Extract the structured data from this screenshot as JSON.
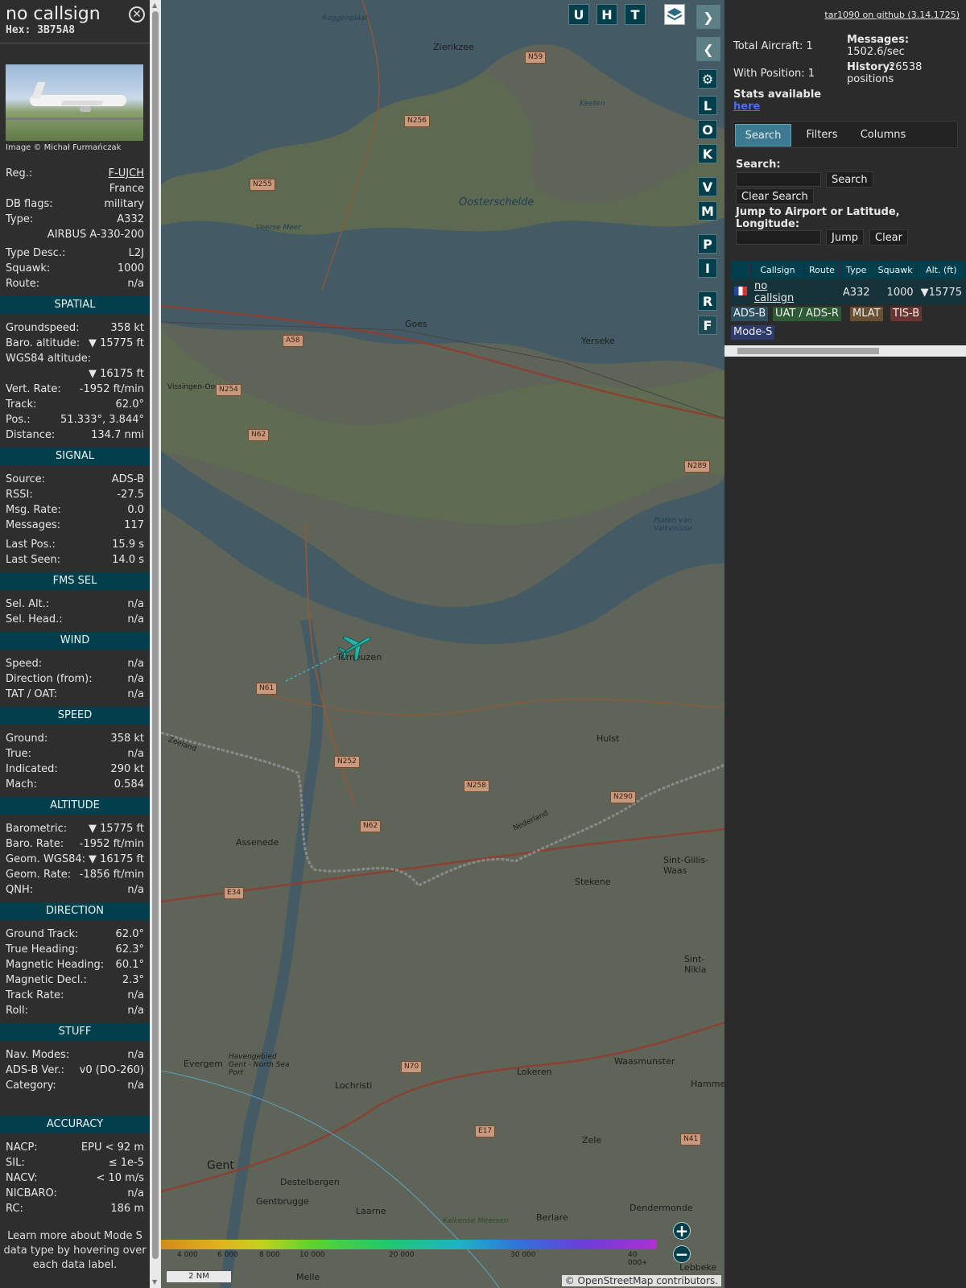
{
  "selected": {
    "callsign": "no callsign",
    "hex": "Hex: 3B75A8",
    "image_credit": "Image © Michał Furmańczak",
    "info": [
      {
        "k": "Reg.:",
        "v": "F-UJCH"
      },
      {
        "k": "",
        "v": "France"
      },
      {
        "k": "DB flags:",
        "v": "military"
      },
      {
        "k": "Type:",
        "v": "A332"
      },
      {
        "k": "",
        "v": "AIRBUS A-330-200"
      },
      {
        "k": "Type Desc.:",
        "v": "L2J"
      },
      {
        "k": "Squawk:",
        "v": "1000"
      },
      {
        "k": "Route:",
        "v": "n/a"
      }
    ],
    "sections": [
      {
        "title": "SPATIAL",
        "rows": [
          {
            "k": "Groundspeed:",
            "v": "358 kt"
          },
          {
            "k": "Baro. altitude:",
            "v": "▼ 15775 ft"
          },
          {
            "k": "WGS84 altitude:",
            "v": ""
          },
          {
            "k": "",
            "v": "▼ 16175 ft"
          },
          {
            "k": "Vert. Rate:",
            "v": "-1952 ft/min"
          },
          {
            "k": "Track:",
            "v": "62.0°"
          },
          {
            "k": "Pos.:",
            "v": "51.333°, 3.844°"
          },
          {
            "k": "Distance:",
            "v": "134.7 nmi"
          }
        ]
      },
      {
        "title": "SIGNAL",
        "rows": [
          {
            "k": "Source:",
            "v": "ADS-B"
          },
          {
            "k": "RSSI:",
            "v": "-27.5"
          },
          {
            "k": "Msg. Rate:",
            "v": "0.0"
          },
          {
            "k": "Messages:",
            "v": "117"
          },
          {
            "k": "Last Pos.:",
            "v": "15.9 s"
          },
          {
            "k": "Last Seen:",
            "v": "14.0 s"
          }
        ]
      },
      {
        "title": "FMS SEL",
        "rows": [
          {
            "k": "Sel. Alt.:",
            "v": "n/a"
          },
          {
            "k": "Sel. Head.:",
            "v": "n/a"
          }
        ]
      },
      {
        "title": "WIND",
        "rows": [
          {
            "k": "Speed:",
            "v": "n/a"
          },
          {
            "k": "Direction (from):",
            "v": "n/a"
          },
          {
            "k": "TAT / OAT:",
            "v": "n/a"
          }
        ]
      },
      {
        "title": "SPEED",
        "rows": [
          {
            "k": "Ground:",
            "v": "358 kt"
          },
          {
            "k": "True:",
            "v": "n/a"
          },
          {
            "k": "Indicated:",
            "v": "290 kt"
          },
          {
            "k": "Mach:",
            "v": "0.584"
          }
        ]
      },
      {
        "title": "ALTITUDE",
        "rows": [
          {
            "k": "Barometric:",
            "v": "▼ 15775 ft"
          },
          {
            "k": "Baro. Rate:",
            "v": "-1952 ft/min"
          },
          {
            "k": "Geom. WGS84:",
            "v": "▼ 16175 ft"
          },
          {
            "k": "Geom. Rate:",
            "v": "-1856 ft/min"
          },
          {
            "k": "QNH:",
            "v": "n/a"
          }
        ]
      },
      {
        "title": "DIRECTION",
        "rows": [
          {
            "k": "Ground Track:",
            "v": "62.0°"
          },
          {
            "k": "True Heading:",
            "v": "62.3°"
          },
          {
            "k": "Magnetic Heading:",
            "v": "60.1°"
          },
          {
            "k": "Magnetic Decl.:",
            "v": "2.3°"
          },
          {
            "k": "Track Rate:",
            "v": "n/a"
          },
          {
            "k": "Roll:",
            "v": "n/a"
          }
        ]
      },
      {
        "title": "STUFF",
        "rows": [
          {
            "k": "Nav. Modes:",
            "v": "n/a"
          },
          {
            "k": "ADS-B Ver.:",
            "v": "v0 (DO-260)"
          },
          {
            "k": "Category:",
            "v": "n/a"
          }
        ]
      },
      {
        "title": "ACCURACY",
        "rows": [
          {
            "k": "NACP:",
            "v": "EPU < 92 m"
          },
          {
            "k": "SIL:",
            "v": "≤ 1e-5"
          },
          {
            "k": "NACV:",
            "v": "< 10 m/s"
          },
          {
            "k": "NICBARO:",
            "v": "n/a"
          },
          {
            "k": "RC:",
            "v": "186 m"
          }
        ]
      }
    ],
    "footer": "Learn more about Mode S data type by hovering over each data label."
  },
  "map": {
    "buttons_top": [
      "U",
      "H",
      "T"
    ],
    "buttons_side": [
      "L",
      "O",
      "K",
      "V",
      "M",
      "P",
      "I",
      "R",
      "F"
    ],
    "scale": "2 NM",
    "attribution": "© OpenStreetMap contributors.",
    "legend_ticks": [
      "4 000",
      "6 000",
      "8 000",
      "10 000",
      "20 000",
      "30 000",
      "40 000+"
    ],
    "places": [
      "Zierikzee",
      "Goes",
      "Yerseke",
      "Terneuzen",
      "Hulst",
      "Assenede",
      "Stekene",
      "Sint-Gillis-Waas",
      "Sint-Nikla",
      "Evergem",
      "Lochristi",
      "Lokeren",
      "Waasmunster",
      "Hamme",
      "Zele",
      "Gent",
      "Destelbergen",
      "Gentbrugge",
      "Laarne",
      "Berlare",
      "Dendermonde",
      "Lebbeke",
      "Melle",
      "Kalkense Meersen",
      "Veerse Meer",
      "Oosterschelde",
      "Roggenplaat",
      "Vissingen-Oost",
      "Zeeland",
      "Nederland",
      "Platen van Valkenisse",
      "Keeten",
      "Havengebied Gent - North Sea Port"
    ],
    "roads": [
      "N59",
      "N256",
      "N255",
      "A58",
      "N254",
      "N62",
      "N289",
      "N61",
      "N252",
      "N258",
      "N290",
      "N62",
      "E34",
      "N70",
      "E17",
      "N41"
    ]
  },
  "panel": {
    "github": "tar1090 on github (3.14.1725)",
    "total_aircraft": "Total Aircraft: 1",
    "with_position": "With Position: 1",
    "stats_available": "Stats available",
    "stats_link": "here",
    "messages_label": "Messages:",
    "messages_rate": "1502.6/sec",
    "history_label": "History:",
    "history_value": "26538 positions",
    "tabs": [
      "Search",
      "Filters",
      "Columns"
    ],
    "search_label": "Search:",
    "search_button": "Search",
    "clear_search": "Clear Search",
    "jump_label": "Jump to Airport or Latitude, Longitude:",
    "jump_button": "Jump",
    "clear_button": "Clear",
    "table_headers": [
      "Callsign",
      "Route",
      "Type",
      "Squawk",
      "Alt. (ft)"
    ],
    "table_rows": [
      [
        "no callsign",
        "",
        "A332",
        "1000",
        "▼15775"
      ]
    ],
    "source_tags": [
      "ADS-B",
      "UAT / ADS-R",
      "MLAT",
      "TIS-B",
      "Mode-S"
    ]
  }
}
